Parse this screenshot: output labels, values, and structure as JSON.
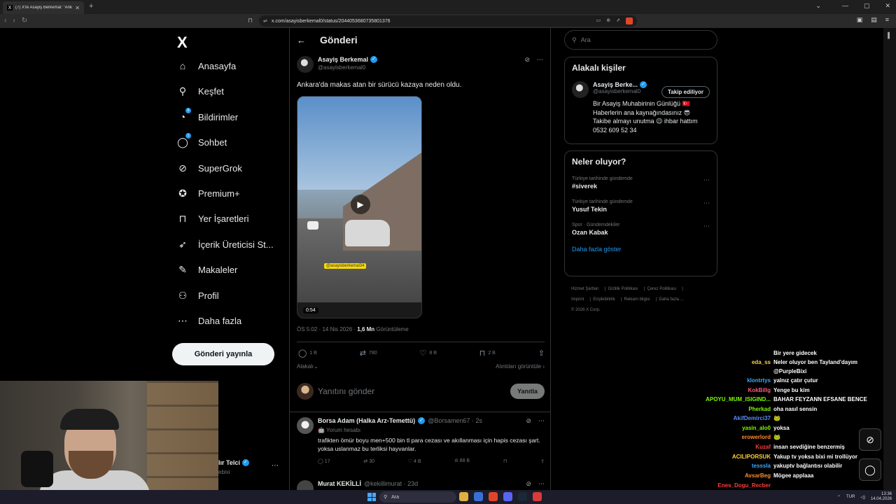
{
  "browser": {
    "tab_title": "(7) X'te Asayiş Berkemal: \"Ankar...",
    "url": "x.com/asayisberkemal0/status/2044053680735801376",
    "tab_favicon": "X"
  },
  "sidebar": {
    "logo": "X",
    "items": [
      {
        "label": "Anasayfa",
        "icon": "home-icon",
        "glyph": "⌂"
      },
      {
        "label": "Keşfet",
        "icon": "search-icon",
        "glyph": "⌕"
      },
      {
        "label": "Bildirimler",
        "icon": "bell-icon",
        "glyph": "🔔",
        "badge": "6"
      },
      {
        "label": "Sohbet",
        "icon": "chat-icon",
        "glyph": "💬",
        "badge": "1"
      },
      {
        "label": "SuperGrok",
        "icon": "grok-icon",
        "glyph": "⊘"
      },
      {
        "label": "Premium+",
        "icon": "premium-icon",
        "glyph": "✓"
      },
      {
        "label": "Yer İşaretleri",
        "icon": "bookmark-icon",
        "glyph": "🔖"
      },
      {
        "label": "İçerik Üreticisi St...",
        "icon": "rocket-icon",
        "glyph": "🚀"
      },
      {
        "label": "Makaleler",
        "icon": "article-icon",
        "glyph": "✎"
      },
      {
        "label": "Profil",
        "icon": "profile-icon",
        "glyph": "👤"
      },
      {
        "label": "Daha fazla",
        "icon": "more-icon",
        "glyph": "⋯"
      }
    ],
    "post_button": "Gönderi yayınla"
  },
  "header": {
    "title": "Gönderi"
  },
  "tweet": {
    "author_name": "Asayiş Berkemal",
    "author_handle": "@asayisberkemal0",
    "text": "Ankara'da makas atan bir sürücü kazaya neden oldu.",
    "video_duration": "0:54",
    "video_watermark": "@asayisberkemal34",
    "time": "ÖS 5:02 · 14 Nis 2026 · ",
    "views": "1,6 Mn",
    "views_label": " Görüntüleme",
    "replies": "1 B",
    "retweets": "780",
    "likes": "8 B",
    "bookmarks": "2 B",
    "related": "Alakalı",
    "quotes": "Alıntıları görüntüle"
  },
  "reply_box": {
    "placeholder": "Yanıtını gönder",
    "button": "Yanıtla"
  },
  "replies": [
    {
      "name": "Borsa Adam (Halka Arz-Temettü)",
      "handle": "@Borsamen67 · 2s",
      "sub": "🤖 Yorum hesabı",
      "text": "trafikten ömür boyu men+500 bin tl para cezası ve akıllanması için hapis cezası şart. yoksa uslanmaz bu terliksi hayvanlar.",
      "replies": "17",
      "retweets": "30",
      "likes": "4 B",
      "views": "88 B"
    },
    {
      "name": "Murat KEKİLLİ",
      "handle": "@kekillimurat · 23d"
    }
  ],
  "right": {
    "search_placeholder": "Ara",
    "related_title": "Alakalı kişiler",
    "related_name": "Asayiş Berke...",
    "related_handle": "@asayisberkemal0",
    "follow_label": "Takip ediliyor",
    "bio_lines": [
      "Bir Asayiş Muhabirinin Günlüğü 🇹🇷",
      "Haberlerin ana kaynağındasınız 😎",
      "Takibe almayı unutma 😉 ihbar hattım",
      "0532 609 52 34"
    ],
    "trends_title": "Neler oluyor?",
    "trends": [
      {
        "context": "Türkiye tarihinde gündemde",
        "name": "#siverek"
      },
      {
        "context": "Türkiye tarihinde gündemde",
        "name": "Yusuf Tekin"
      },
      {
        "context": "Spor · Gündemdekiler",
        "name": "Ozan Kabak"
      }
    ],
    "show_more": "Daha fazla göster",
    "footer_line1": [
      "Hizmet Şartları",
      "Gizlilik Politikası",
      "Çerez Politikası"
    ],
    "footer_line2": [
      "Imprint",
      "Erişilebilirlik",
      "Reklam bilgisi",
      "Daha fazla ..."
    ],
    "copyright": "© 2026 X Corp."
  },
  "chat": [
    {
      "user": "",
      "msg": "Bir yere gidecek",
      "color": "#ffffff"
    },
    {
      "user": "eda_ss",
      "msg": "Neler oluyor ben Tayland'dayım",
      "color": "#ffd23f"
    },
    {
      "user": "",
      "msg": "@PurpleBixi",
      "color": "#ffffff"
    },
    {
      "user": "klontrtys",
      "msg": "yalnız çatır çutur",
      "color": "#3fa9f5"
    },
    {
      "user": "KokBillg",
      "msg": "Yenge bu kim",
      "color": "#ff5a7a"
    },
    {
      "user": "APOYU_MUM_ISIGIND...",
      "msg": "BAHAR FEYZANN EFSANE BENCE",
      "color": "#7cfc00"
    },
    {
      "user": "Pherkad",
      "msg": "oha nasıl sensin",
      "color": "#7cfc00"
    },
    {
      "user": "AkifDemirci37",
      "msg": "🐸",
      "color": "#5b8cff"
    },
    {
      "user": "yasin_alo0",
      "msg": "yoksa",
      "color": "#7cfc00"
    },
    {
      "user": "erowerlord",
      "msg": "🐸",
      "color": "#ff8c2a"
    },
    {
      "user": "Kuzaf",
      "msg": "insan sevdiğine benzermiş",
      "color": "#ff3b3b"
    },
    {
      "user": "ACILIPORSUK",
      "msg": "Yakup tv yoksa bixi mi trollüyor",
      "color": "#ffd23f"
    },
    {
      "user": "tesssla",
      "msg": "yakuptv bağlantısı olabilir",
      "color": "#3fa9f5"
    },
    {
      "user": "AvsarBeg",
      "msg": "Mögee applaaa",
      "color": "#ff8c2a"
    },
    {
      "user": "Enes_Dogu_Recber",
      "msg": "",
      "color": "#ff3b3b"
    }
  ],
  "webcam_overlay": {
    "name": "lır Telci",
    "handle": "ebixi"
  },
  "taskbar": {
    "search": "Ara",
    "lang": "TUR",
    "time": "13:36",
    "date": "14.04.2026"
  }
}
